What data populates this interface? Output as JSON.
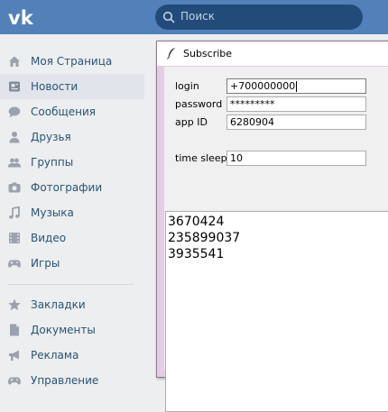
{
  "search": {
    "placeholder": "Поиск"
  },
  "sidebar": {
    "items": [
      {
        "label": "Моя Страница",
        "icon": "home-icon"
      },
      {
        "label": "Новости",
        "icon": "news-icon",
        "active": true
      },
      {
        "label": "Сообщения",
        "icon": "messages-icon"
      },
      {
        "label": "Друзья",
        "icon": "person-icon"
      },
      {
        "label": "Группы",
        "icon": "group-icon"
      },
      {
        "label": "Фотографии",
        "icon": "camera-icon"
      },
      {
        "label": "Музыка",
        "icon": "music-icon"
      },
      {
        "label": "Видео",
        "icon": "video-icon"
      },
      {
        "label": "Игры",
        "icon": "gamepad-icon"
      },
      {
        "label": "Закладки",
        "icon": "star-icon"
      },
      {
        "label": "Документы",
        "icon": "document-icon"
      },
      {
        "label": "Реклама",
        "icon": "megaphone-icon"
      },
      {
        "label": "Управление",
        "icon": "gamepad-icon"
      }
    ]
  },
  "dialog": {
    "title": "Subscribe",
    "login_label": "login",
    "login_value": "+700000000",
    "password_label": "password",
    "password_value": "*********",
    "appid_label": "app ID",
    "appid_value": "6280904",
    "timesleep_label": "time sleep",
    "timesleep_value": "10",
    "output_lines": [
      "3670424",
      "235899037",
      "3935541"
    ]
  },
  "colors": {
    "header": "#5181b8",
    "search_bg": "#224b7a",
    "sidebar_text": "#285473",
    "window_border": "#e6cde6"
  }
}
